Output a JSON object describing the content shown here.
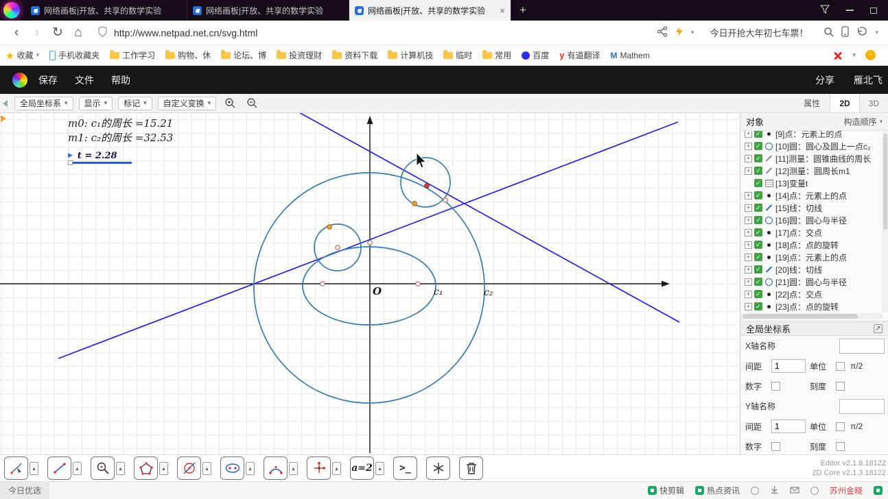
{
  "icons": {
    "plus": "+",
    "close": "×",
    "back": "‹",
    "forward": "›",
    "refresh": "↻",
    "home": "⌂",
    "caret_down": "▾",
    "caret_up": "▴",
    "play": "▶",
    "star": "★",
    "check": "✓",
    "minus": "−",
    "external": "↗",
    "youdao": "y",
    "mathem": "M"
  },
  "browser": {
    "tabs": [
      {
        "title": "网络画板|开放、共享的数学实验"
      },
      {
        "title": "网络画板|开放、共享的数学实验"
      },
      {
        "title": "网络画板|开放、共享的数学实验"
      }
    ],
    "url": "http://www.netpad.net.cn/svg.html",
    "promo": "今日开抢大年初七车票！",
    "bookmarks": [
      {
        "label": "收藏"
      },
      {
        "label": "手机收藏夹"
      },
      {
        "label": "工作学习"
      },
      {
        "label": "购物、休"
      },
      {
        "label": "论坛、博"
      },
      {
        "label": "投资理财"
      },
      {
        "label": "资料下载"
      },
      {
        "label": "计算机技"
      },
      {
        "label": "临时"
      },
      {
        "label": "常用"
      },
      {
        "label": "百度"
      },
      {
        "label": "有道翻译"
      },
      {
        "label": "Mathem"
      }
    ]
  },
  "app": {
    "menus": [
      "保存",
      "文件",
      "帮助"
    ],
    "share": "分享",
    "user": "雁北飞",
    "toolbar": {
      "dropdowns": [
        "全局坐标系",
        "显示",
        "标记",
        "自定义变换"
      ],
      "properties": "属性",
      "view2d": "2D",
      "view3d": "3D"
    }
  },
  "canvas": {
    "measure1": "m0: c₁的周长 =15.21",
    "measure2": "m1: c₂的周长 =32.53",
    "variable": "t = 2.28",
    "origin_label": "O",
    "c1_label": "c₁",
    "c2_label": "c₂"
  },
  "sidebar": {
    "title": "对象",
    "order": "构造顺序",
    "items": [
      {
        "label": "[9]点：元素上的点"
      },
      {
        "label": "[10]圆：圆心及圆上一点c₂"
      },
      {
        "label": "[11]测量：圆锥曲线的周长"
      },
      {
        "label": "[12]测量：圆周长m1"
      },
      {
        "label": "[13]变量t"
      },
      {
        "label": "[14]点：元素上的点"
      },
      {
        "label": "[15]线：切线"
      },
      {
        "label": "[16]圆：圆心与半径"
      },
      {
        "label": "[17]点：交点"
      },
      {
        "label": "[18]点：点的旋转"
      },
      {
        "label": "[19]点：元素上的点"
      },
      {
        "label": "[20]线：切线"
      },
      {
        "label": "[21]圆：圆心与半径"
      },
      {
        "label": "[22]点：交点"
      },
      {
        "label": "[23]点：点的旋转"
      }
    ],
    "panel": {
      "title": "全局坐标系",
      "x_name": "X轴名称",
      "y_name": "Y轴名称",
      "spacing": "间距",
      "spacing_value": "1",
      "unit": "单位",
      "unit_value": "π/2",
      "number": "数字",
      "ticks": "刻度"
    }
  },
  "tools": {
    "algebra": "a=2",
    "console": ">_"
  },
  "versions": {
    "editor": "Editor v2.1.8.18122",
    "core": "2D Core v2.1.3.18122"
  },
  "statusbar": {
    "left": "今日优选",
    "quick_edit": "快剪辑",
    "hot_news": "热点资讯",
    "location": "苏州金晓"
  }
}
